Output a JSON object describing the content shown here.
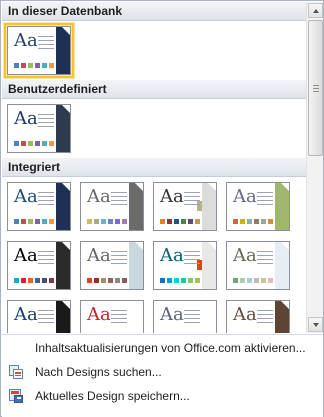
{
  "sections": [
    {
      "title": "In dieser Datenbank",
      "rows": [
        [
          {
            "name": "current",
            "heading_color": "#2b3f6b",
            "band": "#1f3056",
            "swatches": [
              "#4f81bd",
              "#c0504d",
              "#9bbb59",
              "#8064a2",
              "#4bacc6",
              "#f79646"
            ],
            "selected": true
          }
        ]
      ]
    },
    {
      "title": "Benutzerdefiniert",
      "rows": [
        [
          {
            "name": "custom",
            "heading_color": "#1f3864",
            "band": "#2e3b4e",
            "swatches": [
              "#4f81bd",
              "#c0504d",
              "#9bbb59",
              "#8064a2",
              "#4bacc6",
              "#f79646"
            ],
            "selected": false
          }
        ]
      ]
    },
    {
      "title": "Integriert",
      "rows": [
        [
          {
            "name": "office",
            "heading_color": "#1f497d",
            "band": "#1f3056",
            "swatches": [
              "#4f81bd",
              "#c0504d",
              "#9bbb59",
              "#8064a2",
              "#4bacc6",
              "#f79646"
            ]
          },
          {
            "name": "apex",
            "heading_color": "#69676d",
            "band": "#6b6b6b",
            "swatches": [
              "#ceb966",
              "#9cb084",
              "#6bb1c9",
              "#6585cf",
              "#7e6bc9",
              "#a379bb"
            ]
          },
          {
            "name": "aspect",
            "heading_color": "#323232",
            "band": "#dcdcdc",
            "accent": "#b3b67c",
            "swatches": [
              "#f07f09",
              "#9f2936",
              "#1b587c",
              "#4e8542",
              "#604878",
              "#c19859"
            ]
          },
          {
            "name": "civic",
            "heading_color": "#646b86",
            "band": "#9fb86d",
            "swatches": [
              "#d16349",
              "#ccb400",
              "#8cadae",
              "#8c7b70",
              "#8fb08c",
              "#d19049"
            ]
          }
        ],
        [
          {
            "name": "concourse",
            "heading_color": "#000000",
            "band": "#2b2b2b",
            "swatches": [
              "#2da2bf",
              "#da1f28",
              "#eb641b",
              "#39639d",
              "#474b78",
              "#7d3c4a"
            ]
          },
          {
            "name": "equity",
            "heading_color": "#696464",
            "band": "#c9d8dd",
            "swatches": [
              "#d34817",
              "#9b2d1f",
              "#a28e6a",
              "#956251",
              "#918485",
              "#855d5d"
            ]
          },
          {
            "name": "flow",
            "heading_color": "#04617b",
            "band": "#e8e8e8",
            "accent": "#d34817",
            "swatches": [
              "#0f6fc6",
              "#009dd9",
              "#0bd0d9",
              "#10cf9b",
              "#7cca62",
              "#a5c249"
            ]
          },
          {
            "name": "foundry",
            "heading_color": "#676a55",
            "band": "#e6eef3",
            "swatches": [
              "#72a376",
              "#b0ccb0",
              "#a8cdd7",
              "#c0beaf",
              "#cec597",
              "#e8b7b7"
            ]
          }
        ],
        [
          {
            "name": "median",
            "heading_color": "#17406d",
            "band": "#1a1a1a",
            "swatches": [
              "#94b6d2",
              "#dd8047",
              "#a5ab81",
              "#d8b25c",
              "#7ba79d",
              "#968c8c"
            ]
          },
          {
            "name": "metro",
            "heading_color": "#c0262d",
            "band": "#ffffff",
            "swatches": [
              "#7fd13b",
              "#ea157a",
              "#feb80a",
              "#00addc",
              "#738ac8",
              "#1ab39f"
            ]
          },
          {
            "name": "module",
            "heading_color": "#5a6378",
            "band": "#ffffff",
            "swatches": [
              "#f0ad00",
              "#60b5cc",
              "#e66c7d",
              "#6bb76d",
              "#e88651",
              "#c64847"
            ]
          },
          {
            "name": "opulent",
            "heading_color": "#6a4a3a",
            "band": "#5e4434",
            "swatches": [
              "#b83d68",
              "#ac66bb",
              "#de6c36",
              "#f9b639",
              "#cf6da4",
              "#fa8d3d"
            ]
          }
        ]
      ]
    }
  ],
  "tile_text": "Aa",
  "menu": {
    "update_label": "Inhaltsaktualisierungen von Office.com aktivieren...",
    "browse_label": "Nach Designs suchen...",
    "save_label": "Aktuelles Design speichern..."
  }
}
